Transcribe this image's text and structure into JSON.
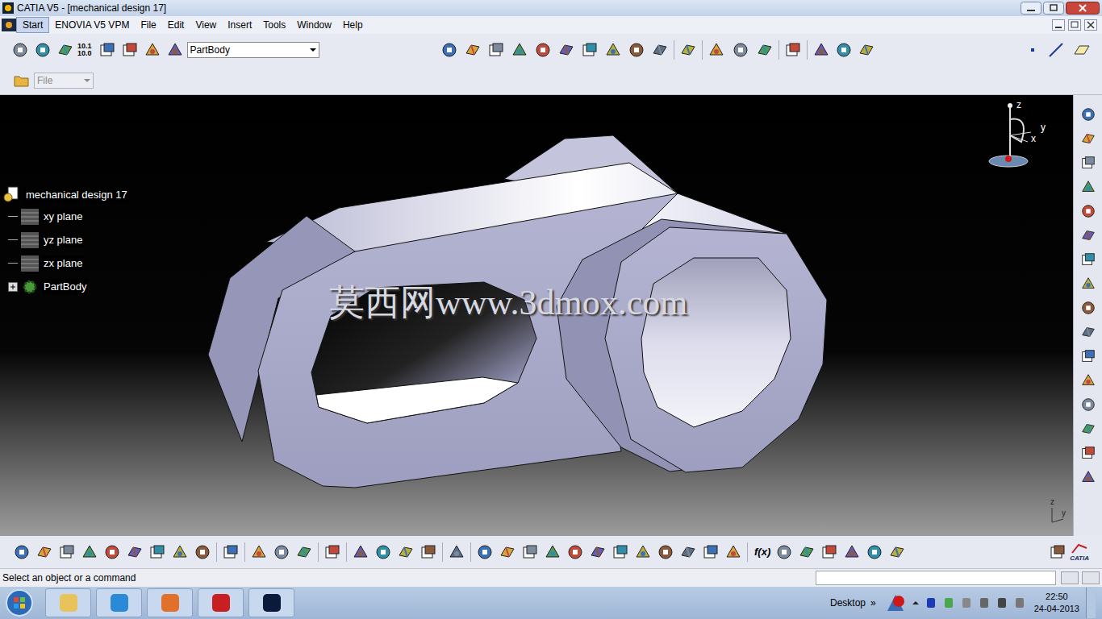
{
  "window": {
    "title": "CATIA V5 - [mechanical design 17]"
  },
  "menu": [
    {
      "label": "Start",
      "selected": true
    },
    {
      "label": "ENOVIA V5 VPM",
      "selected": false
    },
    {
      "label": "File",
      "selected": false
    },
    {
      "label": "Edit",
      "selected": false
    },
    {
      "label": "View",
      "selected": false
    },
    {
      "label": "Insert",
      "selected": false
    },
    {
      "label": "Tools",
      "selected": false
    },
    {
      "label": "Window",
      "selected": false
    },
    {
      "label": "Help",
      "selected": false
    }
  ],
  "toolbar": {
    "dropdown": "PartBody",
    "icon_texts": [
      "10.1",
      "10.0"
    ]
  },
  "second_toolbar": {
    "dropdown": {
      "value": "File",
      "disabled": true
    }
  },
  "tree": {
    "root": "mechanical design 17",
    "items": [
      {
        "label": "xy plane",
        "kind": "plane",
        "expanded": false
      },
      {
        "label": "yz plane",
        "kind": "plane",
        "expanded": false
      },
      {
        "label": "zx plane",
        "kind": "plane",
        "expanded": false
      },
      {
        "label": "PartBody",
        "kind": "body",
        "expanded": false
      }
    ]
  },
  "viewport": {
    "watermark": "莫西网www.3dmox.com",
    "compass_axes": [
      "z",
      "y",
      "x"
    ],
    "mini_axes": [
      "z",
      "y"
    ]
  },
  "bottom_toolbar": {
    "formula_icon": "f(x)",
    "brand": "CATIA"
  },
  "status_bar": {
    "message": "Select an object or a command",
    "input": ""
  },
  "taskbar": {
    "desktop": "Desktop",
    "chevron": "»",
    "time": "22:50",
    "date": "24-04-2013"
  }
}
